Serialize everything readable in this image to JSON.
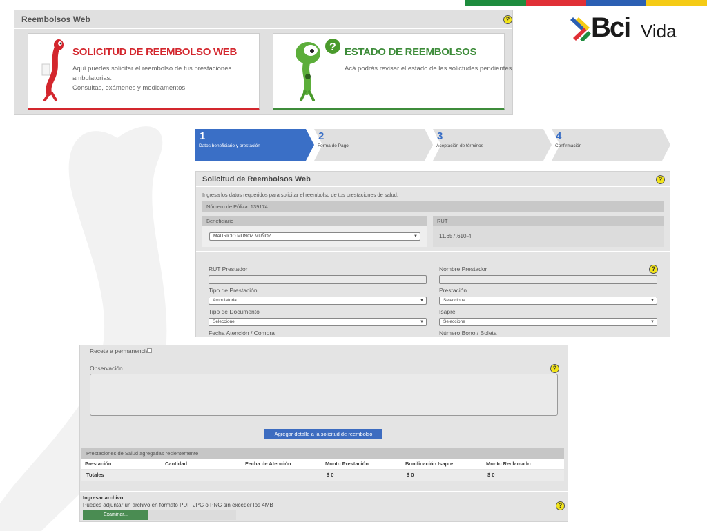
{
  "colors": {
    "stripe_green": "#1e8c3e",
    "stripe_red": "#e03036",
    "stripe_blue": "#2b5fb3",
    "stripe_yellow": "#f5cb15",
    "active_step": "#3a6fc6",
    "inactive_step": "#e0e0e0",
    "red_card": "#d3262d",
    "green_card": "#3e8c3a",
    "add_button": "#3d6cc0",
    "browse_button": "#4a8c52"
  },
  "brand": {
    "logo_main": "Bci",
    "logo_sub": "Vida"
  },
  "top_panel": {
    "title": "Reembolsos Web",
    "help_icon": "?",
    "cards": [
      {
        "title": "SOLICITUD DE REEMBOLSO WEB",
        "line1": "Aquí puedes solicitar el reembolso de tus prestaciones ambulatorias:",
        "line2": "Consultas, exámenes y medicamentos."
      },
      {
        "title": "ESTADO DE REEMBOLSOS",
        "line1": "Acá podrás revisar el estado de las solictudes pendientes.",
        "line2": ""
      }
    ]
  },
  "wizard": {
    "steps": [
      {
        "number": "1",
        "label": "Datos beneficiario y prestación"
      },
      {
        "number": "2",
        "label": "Forma de Pago"
      },
      {
        "number": "3",
        "label": "Aceptación de términos"
      },
      {
        "number": "4",
        "label": "Confirmación"
      }
    ]
  },
  "form": {
    "title": "Solicitud de Reembolsos Web",
    "intro": "Ingresa los datos requeridos para solicitar el reembolso de tus prestaciones de salud.",
    "policy": "Número de Póliza: 139174",
    "beneficiary_label": "Beneficiario",
    "beneficiary_value": "MAURICIO MUNOZ MUÑOZ",
    "rut_label": "RUT",
    "rut_value": "11.657.610-4",
    "rut_prestador_label": "RUT Prestador",
    "nombre_prestador_label": "Nombre Prestador",
    "tipo_prestacion_label": "Tipo de Prestación",
    "tipo_prestacion_value": "Ambulatoria",
    "prestacion_label": "Prestación",
    "prestacion_value": "Seleccione",
    "tipo_documento_label": "Tipo de Documento",
    "tipo_documento_value": "Seleccione",
    "isapre_label": "Isapre",
    "isapre_value": "Seleccione",
    "fecha_label": "Fecha Atención / Compra",
    "numero_bono_label": "Número Bono / Boleta"
  },
  "detail": {
    "receta_label": "Receta a permanencia",
    "observacion_label": "Observación",
    "add_button": "Agregar detalle a la solicitud de reembolso",
    "recent_header": "Prestaciones de Salud agregadas recientemente",
    "columns": [
      "Prestación",
      "Cantidad",
      "Fecha de Atención",
      "Monto Prestación",
      "Bonificación Isapre",
      "Monto Reclamado"
    ],
    "totals_label": "Totales",
    "totals": [
      "$ 0",
      "$ 0",
      "$ 0"
    ],
    "upload_title": "Ingresar archivo",
    "upload_desc": "Puedes adjuntar un archivo en formato PDF, JPG o PNG sin exceder los 4MB",
    "browse_button": "Examinar..."
  }
}
